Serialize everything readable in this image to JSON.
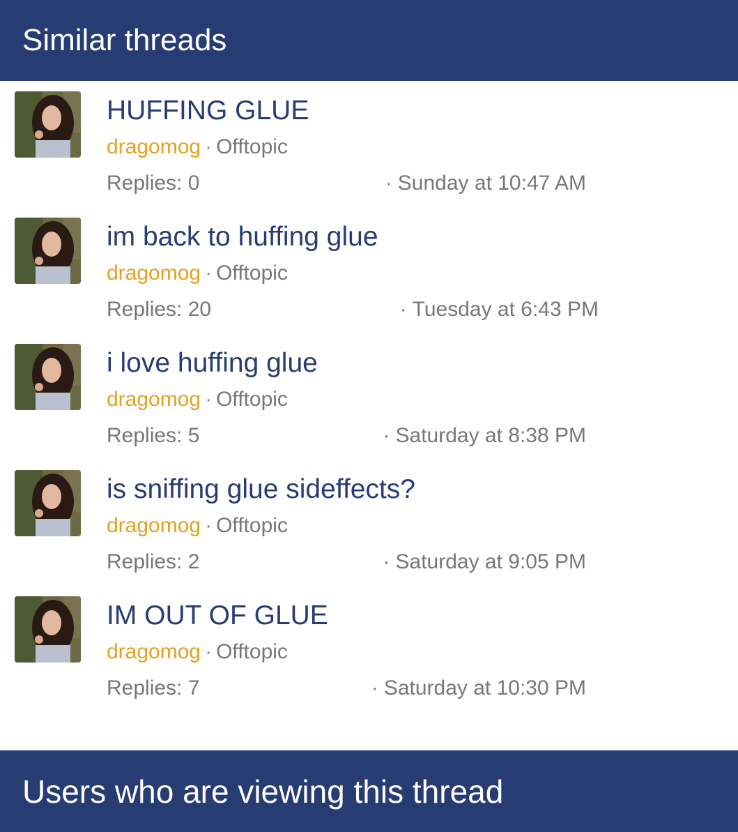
{
  "similar": {
    "header": "Similar threads",
    "threads": [
      {
        "title": "HUFFING GLUE",
        "author": "dragomog",
        "forum": "Offtopic",
        "replies": "Replies: 0",
        "date": "Sunday at 10:47 AM"
      },
      {
        "title": "im back to huffing glue",
        "author": "dragomog",
        "forum": "Offtopic",
        "replies": "Replies: 20",
        "date": "Tuesday at 6:43 PM"
      },
      {
        "title": "i love huffing glue",
        "author": "dragomog",
        "forum": "Offtopic",
        "replies": "Replies: 5",
        "date": "Saturday at 8:38 PM"
      },
      {
        "title": "is sniffing glue sideffects?",
        "author": "dragomog",
        "forum": "Offtopic",
        "replies": "Replies: 2",
        "date": "Saturday at 9:05 PM"
      },
      {
        "title": "IM OUT OF GLUE",
        "author": "dragomog",
        "forum": "Offtopic",
        "replies": "Replies: 7",
        "date": "Saturday at 10:30 PM"
      }
    ]
  },
  "viewers": {
    "header": "Users who are viewing this thread"
  },
  "separator": "·",
  "colors": {
    "header_bg": "#283c74",
    "title": "#283c74",
    "author": "#e5a01f",
    "meta": "#777777"
  }
}
